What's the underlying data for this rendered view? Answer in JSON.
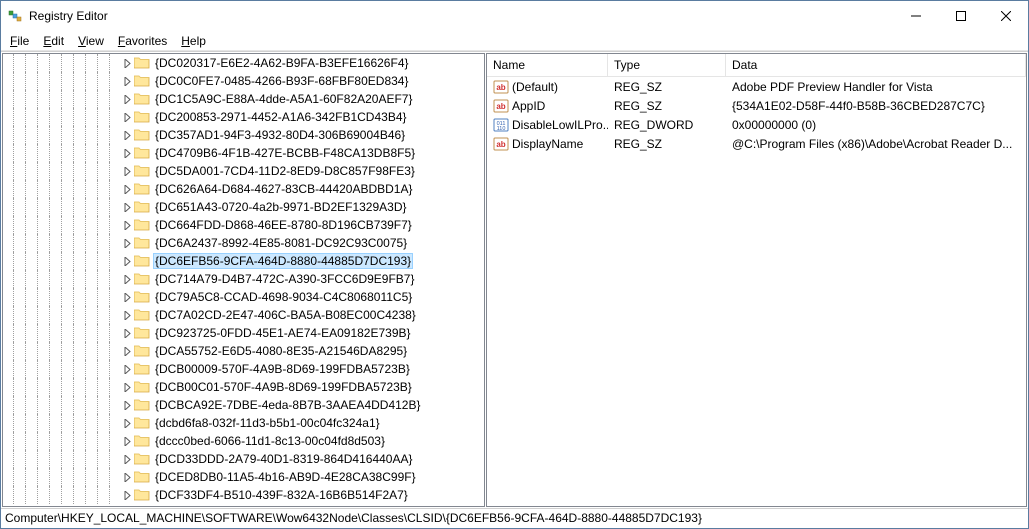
{
  "window": {
    "title": "Registry Editor"
  },
  "menu": {
    "file": "File",
    "edit": "Edit",
    "view": "View",
    "favorites": "Favorites",
    "help": "Help"
  },
  "tree": {
    "indent_levels": 9,
    "items": [
      {
        "label": "{DC020317-E6E2-4A62-B9FA-B3EFE16626F4}",
        "selected": false
      },
      {
        "label": "{DC0C0FE7-0485-4266-B93F-68FBF80ED834}",
        "selected": false
      },
      {
        "label": "{DC1C5A9C-E88A-4dde-A5A1-60F82A20AEF7}",
        "selected": false
      },
      {
        "label": "{DC200853-2971-4452-A1A6-342FB1CD43B4}",
        "selected": false
      },
      {
        "label": "{DC357AD1-94F3-4932-80D4-306B69004B46}",
        "selected": false
      },
      {
        "label": "{DC4709B6-4F1B-427E-BCBB-F48CA13DB8F5}",
        "selected": false
      },
      {
        "label": "{DC5DA001-7CD4-11D2-8ED9-D8C857F98FE3}",
        "selected": false
      },
      {
        "label": "{DC626A64-D684-4627-83CB-44420ABDBD1A}",
        "selected": false
      },
      {
        "label": "{DC651A43-0720-4a2b-9971-BD2EF1329A3D}",
        "selected": false
      },
      {
        "label": "{DC664FDD-D868-46EE-8780-8D196CB739F7}",
        "selected": false
      },
      {
        "label": "{DC6A2437-8992-4E85-8081-DC92C93C0075}",
        "selected": false
      },
      {
        "label": "{DC6EFB56-9CFA-464D-8880-44885D7DC193}",
        "selected": true
      },
      {
        "label": "{DC714A79-D4B7-472C-A390-3FCC6D9E9FB7}",
        "selected": false
      },
      {
        "label": "{DC79A5C8-CCAD-4698-9034-C4C8068011C5}",
        "selected": false
      },
      {
        "label": "{DC7A02CD-2E47-406C-BA5A-B08EC00C4238}",
        "selected": false
      },
      {
        "label": "{DC923725-0FDD-45E1-AE74-EA09182E739B}",
        "selected": false
      },
      {
        "label": "{DCA55752-E6D5-4080-8E35-A21546DA8295}",
        "selected": false
      },
      {
        "label": "{DCB00009-570F-4A9B-8D69-199FDBA5723B}",
        "selected": false
      },
      {
        "label": "{DCB00C01-570F-4A9B-8D69-199FDBA5723B}",
        "selected": false
      },
      {
        "label": "{DCBCA92E-7DBE-4eda-8B7B-3AAEA4DD412B}",
        "selected": false
      },
      {
        "label": "{dcbd6fa8-032f-11d3-b5b1-00c04fc324a1}",
        "selected": false
      },
      {
        "label": "{dccc0bed-6066-11d1-8c13-00c04fd8d503}",
        "selected": false
      },
      {
        "label": "{DCD33DDD-2A79-40D1-8319-864D416440AA}",
        "selected": false
      },
      {
        "label": "{DCED8DB0-11A5-4b16-AB9D-4E28CA38C99F}",
        "selected": false
      },
      {
        "label": "{DCF33DF4-B510-439F-832A-16B6B514F2A7}",
        "selected": false
      }
    ]
  },
  "list": {
    "columns": {
      "name": "Name",
      "type": "Type",
      "data": "Data"
    },
    "rows": [
      {
        "icon": "sz",
        "name": "(Default)",
        "type": "REG_SZ",
        "data": "Adobe PDF Preview Handler for Vista"
      },
      {
        "icon": "sz",
        "name": "AppID",
        "type": "REG_SZ",
        "data": "{534A1E02-D58F-44f0-B58B-36CBED287C7C}"
      },
      {
        "icon": "dw",
        "name": "DisableLowILPro...",
        "type": "REG_DWORD",
        "data": "0x00000000 (0)"
      },
      {
        "icon": "sz",
        "name": "DisplayName",
        "type": "REG_SZ",
        "data": "@C:\\Program Files (x86)\\Adobe\\Acrobat Reader D..."
      }
    ]
  },
  "statusbar": {
    "path": "Computer\\HKEY_LOCAL_MACHINE\\SOFTWARE\\Wow6432Node\\Classes\\CLSID\\{DC6EFB56-9CFA-464D-8880-44885D7DC193}"
  }
}
